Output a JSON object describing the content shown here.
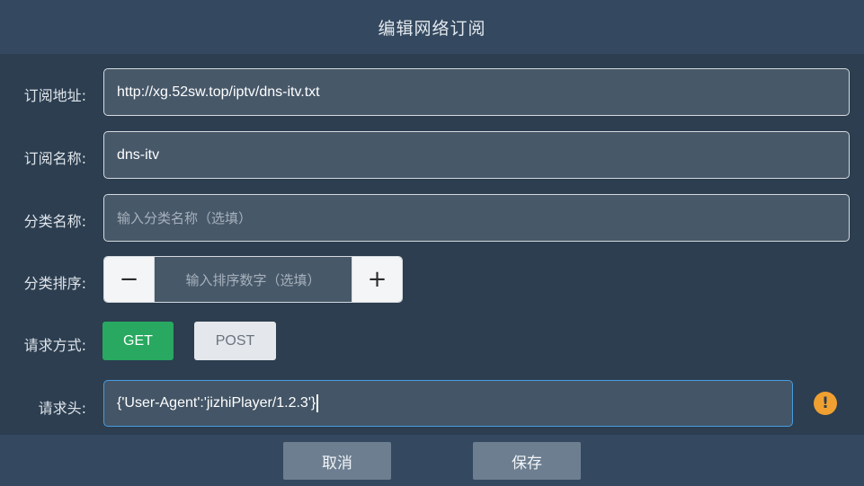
{
  "dialog": {
    "title": "编辑网络订阅"
  },
  "form": {
    "url": {
      "label": "订阅地址:",
      "value": "http://xg.52sw.top/iptv/dns-itv.txt"
    },
    "name": {
      "label": "订阅名称:",
      "value": "dns-itv"
    },
    "category": {
      "label": "分类名称:",
      "placeholder": "输入分类名称（选填）"
    },
    "order": {
      "label": "分类排序:",
      "minus": "−",
      "placeholder": "输入排序数字（选填）",
      "plus": "+"
    },
    "method": {
      "label": "请求方式:",
      "options": [
        "GET",
        "POST"
      ],
      "selected": "GET"
    },
    "headers": {
      "label": "请求头:",
      "value": "{'User-Agent':'jizhiPlayer/1.2.3'}",
      "warning_icon": "exclamation-icon"
    }
  },
  "footer": {
    "cancel_label": "取消",
    "save_label": "保存"
  },
  "colors": {
    "accent_green": "#28a860",
    "focus_blue": "#4a9ce0",
    "warning_orange": "#f0a030"
  }
}
